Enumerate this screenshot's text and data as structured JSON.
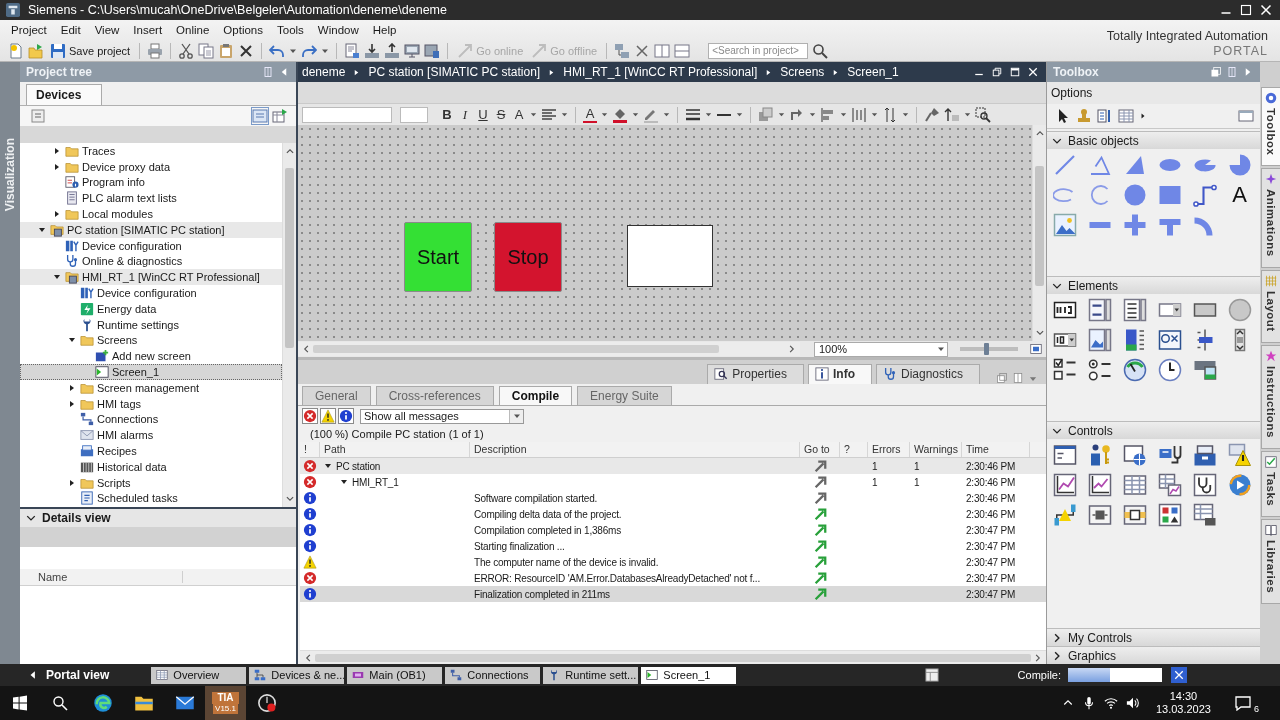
{
  "window": {
    "title": "Siemens - C:\\Users\\mucah\\OneDrive\\Belgeler\\Automation\\deneme\\deneme"
  },
  "menu": [
    "Project",
    "Edit",
    "View",
    "Insert",
    "Online",
    "Options",
    "Tools",
    "Window",
    "Help"
  ],
  "brand": {
    "line_1": "Totally Integrated Automation",
    "line_2": "PORTAL"
  },
  "toolbar": {
    "save": "Save project",
    "go_online": {
      "label": "Go online",
      "disabled": true
    },
    "go_offline": {
      "label": "Go offline",
      "disabled": true
    },
    "search": {
      "placeholder": "<Search in project>"
    }
  },
  "left_tab": "Visualization",
  "project_tree": {
    "title": "Project tree",
    "tab": "Devices",
    "items": [
      {
        "children": [
          {
            "label": "Traces",
            "kind": "folder",
            "expanded": false,
            "selected": false
          },
          {
            "label": "Device proxy data",
            "kind": "folder",
            "expanded": false,
            "selected": false
          },
          {
            "label": "Program info",
            "kind": "info",
            "selected": false
          },
          {
            "label": "PLC alarm text lists",
            "kind": "textlist",
            "selected": false
          },
          {
            "label": "Local modules",
            "kind": "folder",
            "expanded": false,
            "selected": false
          }
        ]
      },
      {
        "label": "PC station [SIMATIC PC station]",
        "kind": "device",
        "expanded": true,
        "selected": false,
        "children": [
          {
            "label": "Device configuration",
            "kind": "config",
            "selected": false
          },
          {
            "label": "Online & diagnostics",
            "kind": "diagnostics",
            "selected": false
          },
          {
            "label": "HMI_RT_1 [WinCC RT Professional]",
            "kind": "device",
            "expanded": true,
            "selected": false,
            "children": [
              {
                "label": "Device configuration",
                "kind": "config",
                "selected": false
              },
              {
                "label": "Energy data",
                "kind": "energy",
                "selected": false
              },
              {
                "label": "Runtime settings",
                "kind": "settings",
                "selected": false
              },
              {
                "label": "Screens",
                "kind": "folder",
                "expanded": true,
                "selected": false,
                "children": [
                  {
                    "label": "Add new screen",
                    "kind": "add",
                    "selected": false
                  },
                  {
                    "label": "Screen_1",
                    "kind": "screen",
                    "selected": true
                  }
                ]
              },
              {
                "label": "Screen management",
                "kind": "folder",
                "expanded": false,
                "selected": false
              },
              {
                "label": "HMI tags",
                "kind": "folder",
                "expanded": false,
                "selected": false
              },
              {
                "label": "Connections",
                "kind": "connections",
                "selected": false
              },
              {
                "label": "HMI alarms",
                "kind": "alarms",
                "selected": false
              },
              {
                "label": "Recipes",
                "kind": "recipes",
                "selected": false
              },
              {
                "label": "Historical data",
                "kind": "archive",
                "selected": false
              },
              {
                "label": "Scripts",
                "kind": "folder",
                "expanded": false,
                "selected": false
              },
              {
                "label": "Scheduled tasks",
                "kind": "tasks",
                "selected": false
              }
            ]
          }
        ]
      }
    ]
  },
  "details_view": {
    "title": "Details view",
    "expanded": true,
    "columns": [
      "Name"
    ]
  },
  "editor": {
    "breadcrumb": [
      "deneme",
      "PC station [SIMATIC PC station]",
      "HMI_RT_1 [WinCC RT Professional]",
      "Screens",
      "Screen_1"
    ],
    "format_buttons": [
      {
        "kind": "bold",
        "text": "B"
      },
      {
        "kind": "italic",
        "text": "I"
      },
      {
        "kind": "underline",
        "text": "U"
      },
      {
        "kind": "strikethrough",
        "text": "S"
      },
      {
        "kind": "grow_font",
        "text": "A"
      },
      {
        "kind": "font_color",
        "text": "A"
      }
    ],
    "screen_objects": [
      {
        "kind": "button",
        "label": "Start",
        "color": "#34e034"
      },
      {
        "kind": "button",
        "label": "Stop",
        "color": "#d3142e"
      },
      {
        "kind": "io_field"
      }
    ],
    "zoom": {
      "value": "100%",
      "level": 0.45
    }
  },
  "inspector": {
    "tabs": [
      {
        "label": "Properties",
        "kind": "properties",
        "selected": false
      },
      {
        "label": "Info",
        "kind": "info",
        "selected": true
      },
      {
        "label": "Diagnostics",
        "kind": "diagnostics",
        "selected": false
      }
    ],
    "subtabs": [
      {
        "label": "General",
        "selected": false
      },
      {
        "label": "Cross-references",
        "selected": false
      },
      {
        "label": "Compile",
        "selected": true
      },
      {
        "label": "Energy Suite",
        "selected": false
      }
    ],
    "filter": "Show all messages",
    "status": "(100 %) Compile PC station (1 of 1)",
    "columns": [
      "!",
      "Path",
      "Description",
      "Go to",
      "?",
      "Errors",
      "Warnings",
      "Time"
    ],
    "rows": [
      {
        "kind": "error",
        "path": "PC station",
        "expanded": true,
        "goto_available": false,
        "errors": "1",
        "warnings": "1",
        "time": "2:30:46 PM",
        "selected": false,
        "children": [
          {
            "kind": "error",
            "path": "HMI_RT_1",
            "expanded": true,
            "goto_available": false,
            "errors": "1",
            "warnings": "1",
            "time": "2:30:46 PM",
            "selected": false,
            "children": [
              {
                "kind": "info",
                "description": "Software compilation started.",
                "goto_available": false,
                "time": "2:30:46 PM",
                "selected": false
              },
              {
                "kind": "info",
                "description": "Compiling delta data of the project.",
                "goto_available": true,
                "time": "2:30:46 PM",
                "selected": false
              },
              {
                "kind": "info",
                "description": "Compilation completed in 1,386ms",
                "goto_available": true,
                "time": "2:30:47 PM",
                "selected": false
              },
              {
                "kind": "info",
                "description": "Starting finalization ...",
                "goto_available": true,
                "time": "2:30:47 PM",
                "selected": false
              },
              {
                "kind": "warning",
                "description": "The computer name of the device is invalid.",
                "goto_available": true,
                "time": "2:30:47 PM",
                "selected": false
              },
              {
                "kind": "error",
                "description": "ERROR: ResourceID 'AM.Error.DatabasesAlreadyDetached' not f...",
                "goto_available": true,
                "time": "2:30:47 PM",
                "selected": false
              },
              {
                "kind": "info",
                "description": "Finalization completed in 211ms",
                "goto_available": true,
                "time": "2:30:47 PM",
                "selected": true
              }
            ]
          }
        ]
      }
    ]
  },
  "toolbox": {
    "title": "Toolbox",
    "options": "Options",
    "panes": [
      {
        "title": "Basic objects",
        "kind": "basic",
        "expanded": true,
        "text_tool_glyph": "A"
      },
      {
        "title": "Elements",
        "kind": "elements",
        "expanded": true
      },
      {
        "title": "Controls",
        "kind": "controls",
        "expanded": true
      },
      {
        "title": "My Controls",
        "expanded": false
      },
      {
        "title": "Graphics",
        "expanded": false
      }
    ]
  },
  "right_tabs": [
    {
      "label": "Toolbox",
      "selected": true
    },
    {
      "label": "Animations",
      "selected": false
    },
    {
      "label": "Layout",
      "selected": false
    },
    {
      "label": "Instructions",
      "selected": false
    },
    {
      "label": "Tasks",
      "selected": false
    },
    {
      "label": "Libraries",
      "selected": false
    }
  ],
  "portal_bar": {
    "portal_view": "Portal view",
    "tabs": [
      {
        "label": "Overview",
        "kind": "overview",
        "selected": false
      },
      {
        "label": "Devices & ne...",
        "kind": "devices",
        "selected": false
      },
      {
        "label": "Main (OB1)",
        "kind": "block",
        "selected": false
      },
      {
        "label": "Connections",
        "kind": "connections",
        "selected": false
      },
      {
        "label": "Runtime sett...",
        "kind": "settings",
        "selected": false
      },
      {
        "label": "Screen_1",
        "kind": "screen",
        "selected": true
      }
    ],
    "compile": {
      "label": "Compile:",
      "level": 0.45
    }
  },
  "taskbar": {
    "apps": [
      {
        "kind": "browser",
        "active": false
      },
      {
        "kind": "files",
        "active": false
      },
      {
        "kind": "mail",
        "active": false
      },
      {
        "kind": "tia",
        "text": "TIA",
        "version": "V15.1",
        "active": true
      },
      {
        "kind": "recorder",
        "active": false
      }
    ],
    "time": "14:30",
    "date": "13.03.2023",
    "notifications": "6"
  }
}
